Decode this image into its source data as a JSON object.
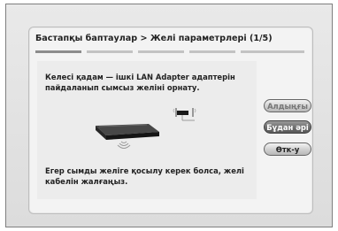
{
  "dialog": {
    "title": "Бастапқы баптаулар > Желі параметрлері (1/5)",
    "steps": {
      "total": 5,
      "current": 1
    },
    "instruction": "Келесі қадам — ішкі LAN Adapter адаптерін пайдаланып сымсыз желіні орнату.",
    "note": "Егер сымды желіге қосылу керек болса, желі кабелін жалғаңыз.",
    "buttons": {
      "previous_label": "Алдыңғы",
      "next_label": "Бұдан әрі",
      "skip_label": "Өтк-у"
    }
  },
  "icons": {
    "device": "blu-ray-player-icon",
    "wireless": "wireless-signal-icon",
    "router": "wireless-router-icon"
  },
  "colors": {
    "background": "#ffffff",
    "panel": "#f3f3f3",
    "focused_button": "#6d6d6d"
  }
}
